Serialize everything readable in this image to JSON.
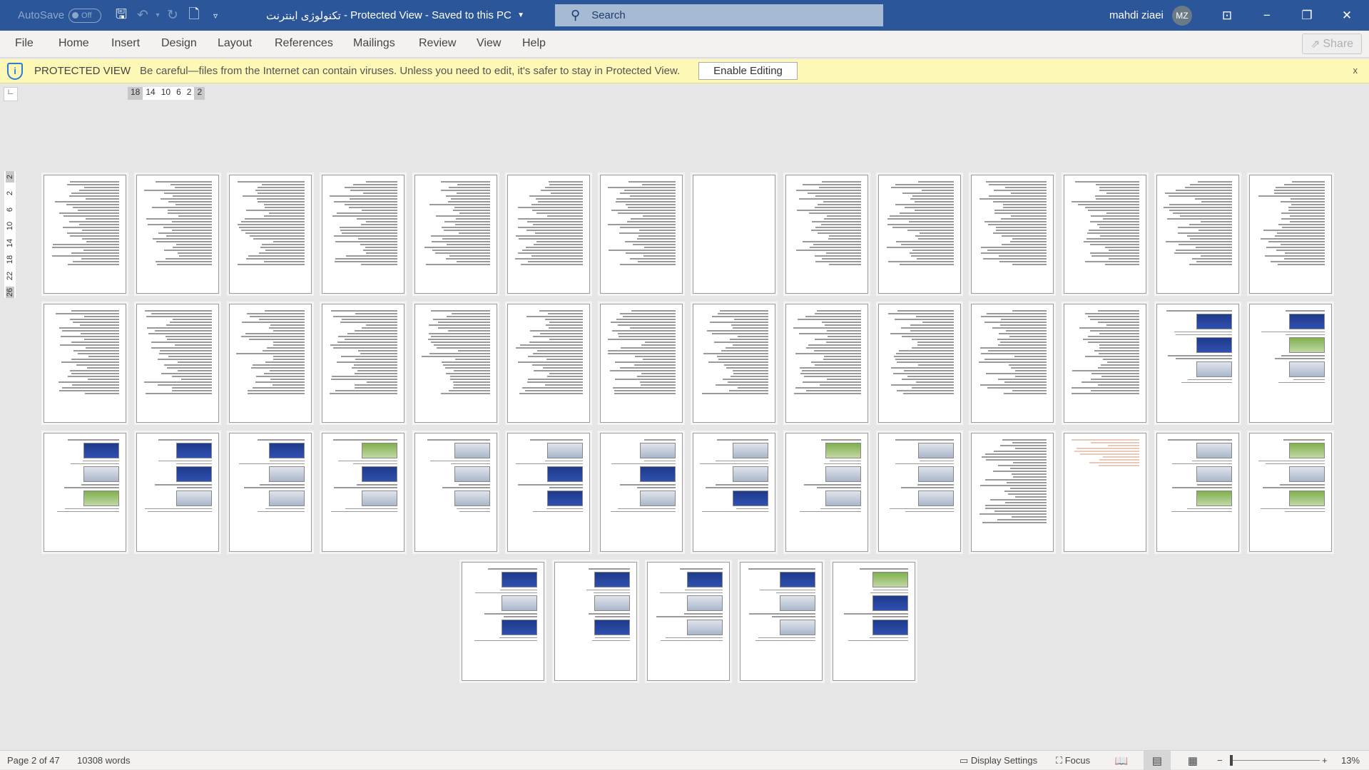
{
  "titlebar": {
    "autosave_label": "AutoSave",
    "autosave_state": "Off",
    "document_title": "تکنولوژی اینترنت",
    "view_mode": "Protected View",
    "save_status": "Saved to this PC",
    "search_placeholder": "Search",
    "user_name": "mahdi ziaei",
    "user_initials": "MZ"
  },
  "ribbon": {
    "tabs": [
      "File",
      "Home",
      "Insert",
      "Design",
      "Layout",
      "References",
      "Mailings",
      "Review",
      "View",
      "Help"
    ],
    "share_label": "Share"
  },
  "protected_view": {
    "label": "PROTECTED VIEW",
    "message": "Be careful—files from the Internet can contain viruses. Unless you need to edit, it's safer to stay in Protected View.",
    "enable_button": "Enable Editing",
    "close": "x"
  },
  "ruler": {
    "horizontal": [
      "18",
      "14",
      "10",
      "6",
      "2",
      "2"
    ],
    "vertical": [
      "2",
      "2",
      "6",
      "10",
      "14",
      "18",
      "22",
      "26"
    ]
  },
  "pages": [
    "text",
    "text",
    "text",
    "text",
    "text",
    "text",
    "text",
    "blank",
    "text",
    "text",
    "text",
    "text",
    "text",
    "text",
    "text",
    "text",
    "text",
    "text",
    "text",
    "text",
    "text",
    "text",
    "text",
    "text",
    "text",
    "text",
    "images",
    "images",
    "images",
    "images",
    "images",
    "images",
    "images",
    "images",
    "images",
    "images",
    "images",
    "images",
    "text",
    "faint",
    "images",
    "images",
    "images",
    "images",
    "images",
    "images",
    "images"
  ],
  "status": {
    "page": "Page 2 of 47",
    "words": "10308 words",
    "display_settings": "Display Settings",
    "focus": "Focus",
    "zoom_minus": "−",
    "zoom_plus": "+",
    "zoom_level": "13%"
  }
}
